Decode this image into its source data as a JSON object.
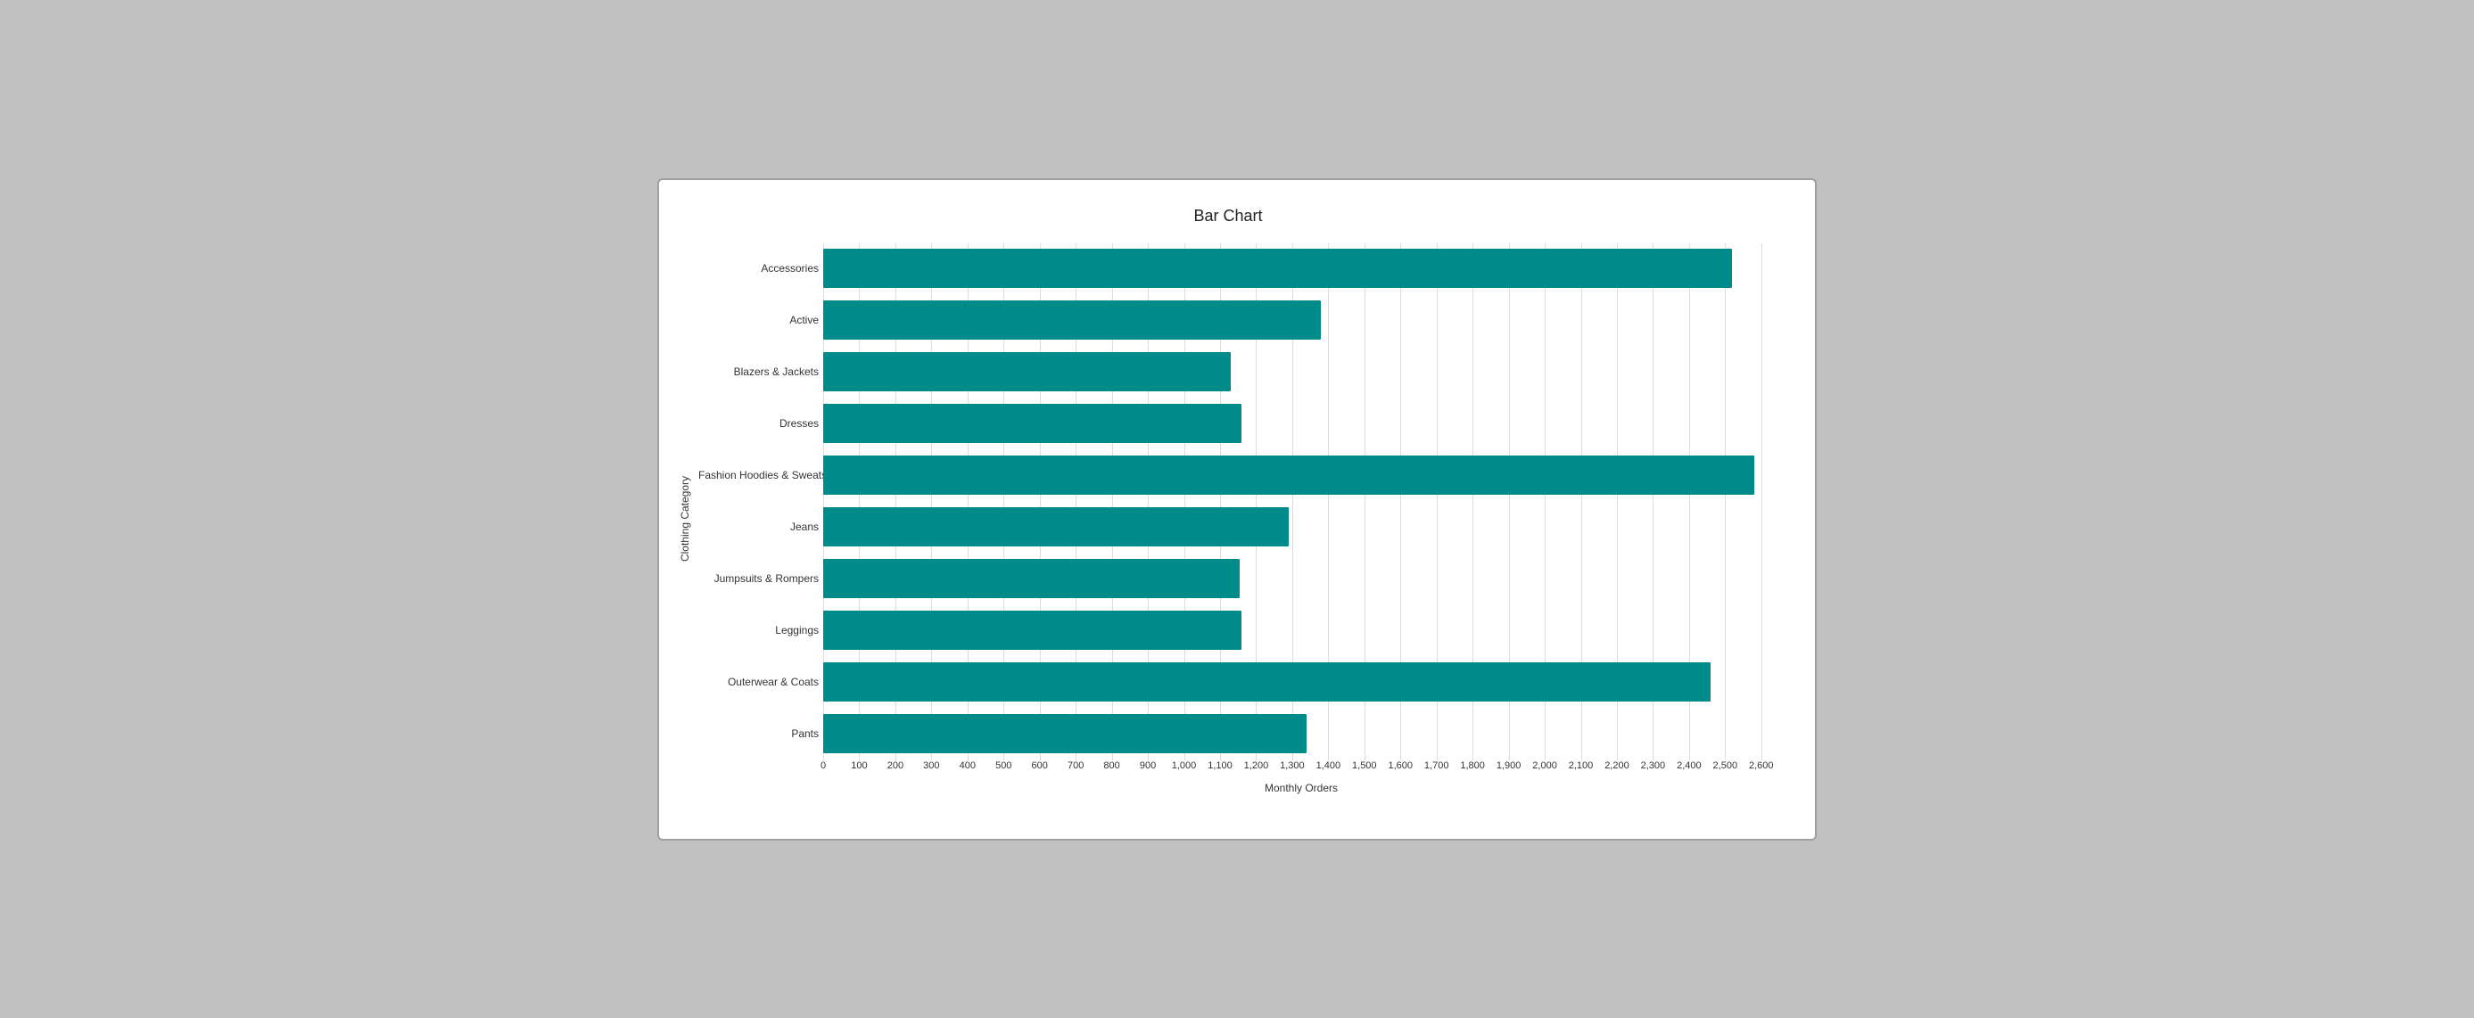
{
  "chart": {
    "title": "Bar Chart",
    "y_axis_label": "Clothing Category",
    "x_axis_label": "Monthly Orders",
    "bar_color": "#008B8B",
    "max_value": 2650,
    "x_ticks": [
      {
        "label": "0",
        "value": 0
      },
      {
        "label": "100",
        "value": 100
      },
      {
        "label": "200",
        "value": 200
      },
      {
        "label": "300",
        "value": 300
      },
      {
        "label": "400",
        "value": 400
      },
      {
        "label": "500",
        "value": 500
      },
      {
        "label": "600",
        "value": 600
      },
      {
        "label": "700",
        "value": 700
      },
      {
        "label": "800",
        "value": 800
      },
      {
        "label": "900",
        "value": 900
      },
      {
        "label": "1,000",
        "value": 1000
      },
      {
        "label": "1,100",
        "value": 1100
      },
      {
        "label": "1,200",
        "value": 1200
      },
      {
        "label": "1,300",
        "value": 1300
      },
      {
        "label": "1,400",
        "value": 1400
      },
      {
        "label": "1,500",
        "value": 1500
      },
      {
        "label": "1,600",
        "value": 1600
      },
      {
        "label": "1,700",
        "value": 1700
      },
      {
        "label": "1,800",
        "value": 1800
      },
      {
        "label": "1,900",
        "value": 1900
      },
      {
        "label": "2,000",
        "value": 2000
      },
      {
        "label": "2,100",
        "value": 2100
      },
      {
        "label": "2,200",
        "value": 2200
      },
      {
        "label": "2,300",
        "value": 2300
      },
      {
        "label": "2,400",
        "value": 2400
      },
      {
        "label": "2,500",
        "value": 2500
      },
      {
        "label": "2,600",
        "value": 2600
      }
    ],
    "bars": [
      {
        "label": "Accessories",
        "value": 2520
      },
      {
        "label": "Active",
        "value": 1380
      },
      {
        "label": "Blazers & Jackets",
        "value": 1130
      },
      {
        "label": "Dresses",
        "value": 1160
      },
      {
        "label": "Fashion Hoodies & Sweatshirts",
        "value": 2580
      },
      {
        "label": "Jeans",
        "value": 1290
      },
      {
        "label": "Jumpsuits & Rompers",
        "value": 1155
      },
      {
        "label": "Leggings",
        "value": 1160
      },
      {
        "label": "Outerwear & Coats",
        "value": 2460
      },
      {
        "label": "Pants",
        "value": 1340
      }
    ]
  }
}
